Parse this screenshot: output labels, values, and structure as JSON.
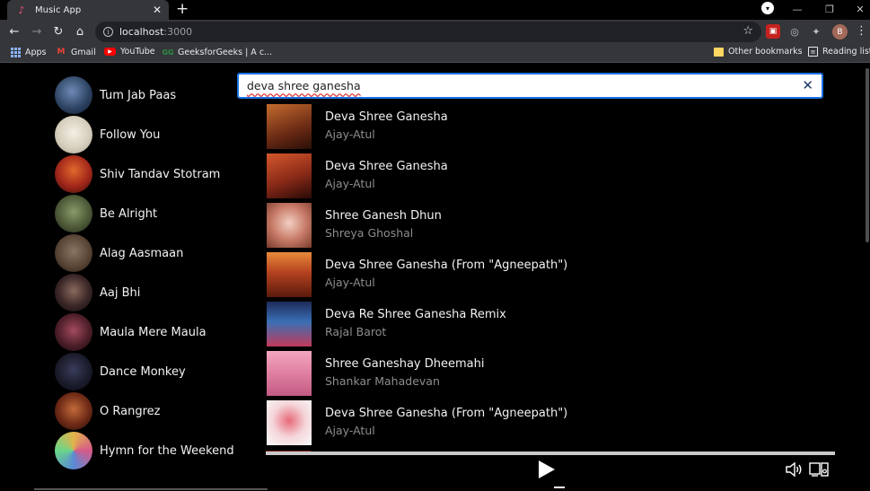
{
  "browser": {
    "tab_title": "Music App",
    "tab_close": "✕",
    "new_tab": "+",
    "url_host": "localhost",
    "url_port": ":3000",
    "profile_initial": "B",
    "win_min": "—",
    "win_restore": "❐",
    "win_close": "✕",
    "bookmarks": [
      {
        "label": "Apps",
        "icon": "apps-grid-icon"
      },
      {
        "label": "Gmail",
        "icon": "gmail-icon"
      },
      {
        "label": "YouTube",
        "icon": "youtube-icon"
      },
      {
        "label": "GeeksforGeeks | A c...",
        "icon": "gfg-icon"
      }
    ],
    "other_bookmarks": "Other bookmarks",
    "reading_list": "Reading list"
  },
  "sidebar": {
    "items": [
      {
        "label": "Tum Jab Paas",
        "color": "#3b5f86"
      },
      {
        "label": "Follow You",
        "color": "#d9d4c7"
      },
      {
        "label": "Shiv Tandav Stotram",
        "color": "#b8321c"
      },
      {
        "label": "Be Alright",
        "color": "#6a7a4a"
      },
      {
        "label": "Alag Aasmaan",
        "color": "#6b5a4a"
      },
      {
        "label": "Aaj Bhi",
        "color": "#3a2a2a"
      },
      {
        "label": "Maula Mere Maula",
        "color": "#5a2a3a"
      },
      {
        "label": "Dance Monkey",
        "color": "#23253a"
      },
      {
        "label": "O Rangrez",
        "color": "#8a3a22"
      },
      {
        "label": "Hymn for the Weekend",
        "color": "#7a4a8a"
      }
    ]
  },
  "search": {
    "value": "deva shree ganesha",
    "clear": "✕"
  },
  "results": [
    {
      "title": "Deva Shree Ganesha",
      "artist": "Ajay-Atul",
      "color": "#8a3b1e"
    },
    {
      "title": "Deva Shree Ganesha",
      "artist": "Ajay-Atul",
      "color": "#a03a20"
    },
    {
      "title": "Shree Ganesh Dhun",
      "artist": "Shreya Ghoshal",
      "color": "#c97d6a"
    },
    {
      "title": "Deva Shree Ganesha (From \"Agneepath\")",
      "artist": "Ajay-Atul",
      "color": "#b5421f"
    },
    {
      "title": "Deva Re Shree Ganesha Remix",
      "artist": "Rajal Barot",
      "color": "#3a6fb5"
    },
    {
      "title": "Shree Ganeshay Dheemahi",
      "artist": "Shankar Mahadevan",
      "color": "#e07fa2"
    },
    {
      "title": "Deva Shree Ganesha (From \"Agneepath\")",
      "artist": "Ajay-Atul",
      "color": "#f2f2f2"
    }
  ],
  "accent": "#1a73e8"
}
